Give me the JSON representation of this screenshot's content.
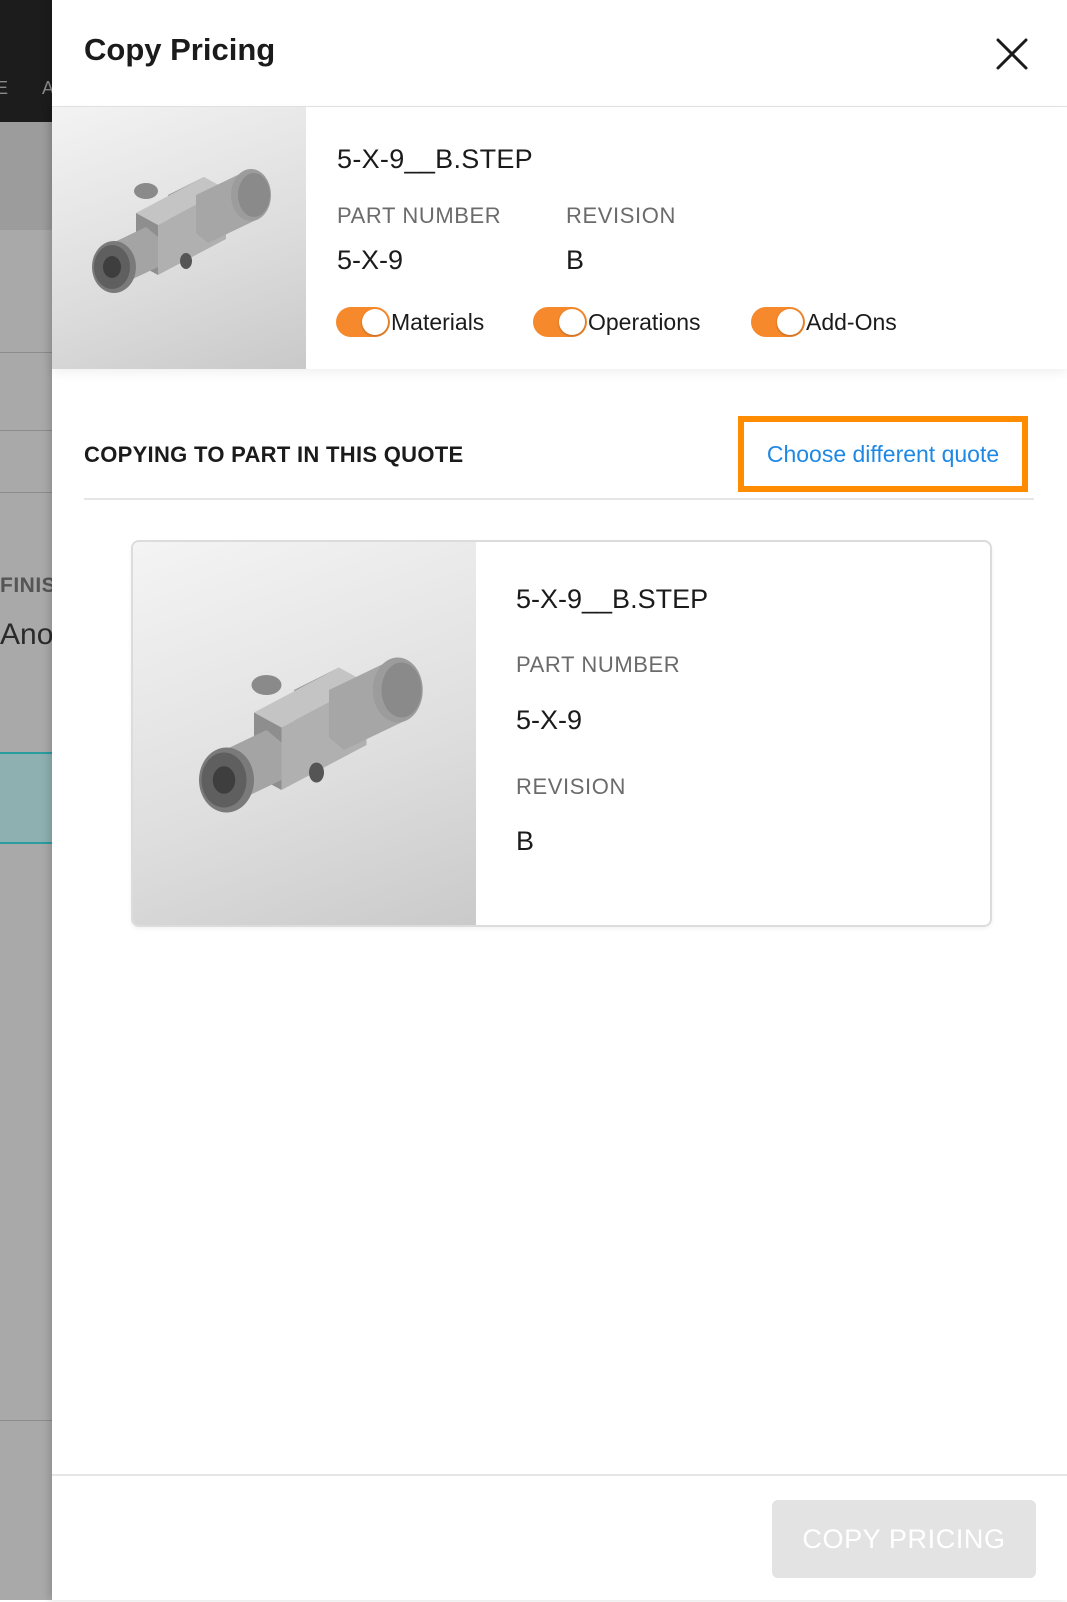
{
  "background": {
    "top_chars": [
      "E",
      "A"
    ],
    "section_label": "FINIS",
    "value_text": "Ano"
  },
  "drawer": {
    "title": "Copy Pricing",
    "close_icon": "close-icon"
  },
  "source_part": {
    "file_name": "5-X-9__B.STEP",
    "part_number_label": "PART NUMBER",
    "part_number": "5-X-9",
    "revision_label": "REVISION",
    "revision": "B",
    "toggles": [
      {
        "label": "Materials",
        "on": true
      },
      {
        "label": "Operations",
        "on": true
      },
      {
        "label": "Add-Ons",
        "on": true
      }
    ]
  },
  "target_section": {
    "title": "COPYING TO PART IN THIS QUOTE",
    "choose_link": "Choose different quote"
  },
  "target_part": {
    "file_name": "5-X-9__B.STEP",
    "part_number_label": "PART NUMBER",
    "part_number": "5-X-9",
    "revision_label": "REVISION",
    "revision": "B"
  },
  "footer": {
    "copy_button": "COPY PRICING",
    "copy_button_disabled": true
  },
  "colors": {
    "toggle_on": "#f5892b",
    "highlight": "#ff8c00",
    "link": "#1e88e5"
  }
}
